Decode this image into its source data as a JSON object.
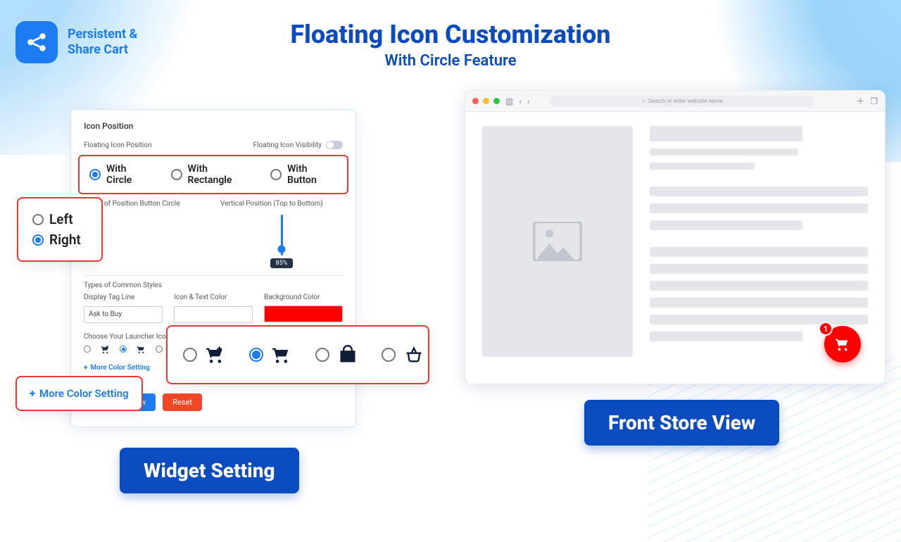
{
  "brand": {
    "line1": "Persistent &",
    "line2": "Share Cart"
  },
  "title": {
    "main": "Floating Icon Customization",
    "sub": "With Circle Feature"
  },
  "panel": {
    "heading": "Icon Position",
    "floating_label": "Floating Icon Position",
    "visibility_label": "Floating Icon Visibility",
    "shape_options": {
      "circle": "With Circle",
      "rect": "With Rectangle",
      "button": "With Button"
    },
    "types_label": "Types of Position Button Circle",
    "vertical_label": "Vertical Position (Top to Bottom)",
    "vertical_value": "85%",
    "common_styles_label": "Types of Common Styles",
    "tagline_label": "Display Tag Line",
    "tagline_value": "Ask to Buy",
    "icon_text_color_label": "Icon & Text Color",
    "bg_color_label": "Background Color",
    "bg_color_value": "#ff0000",
    "launcher_label": "Choose Your Launcher Icon",
    "more_link": "More Color Setting",
    "save_btn": "Save & Preview",
    "reset_btn": "Reset"
  },
  "position_callout": {
    "left": "Left",
    "right": "Right"
  },
  "more_callout": "More Color Setting",
  "browser": {
    "placeholder": "Search or enter website name"
  },
  "float": {
    "badge": "1"
  },
  "chips": {
    "left": "Widget Setting",
    "right": "Front Store View"
  }
}
